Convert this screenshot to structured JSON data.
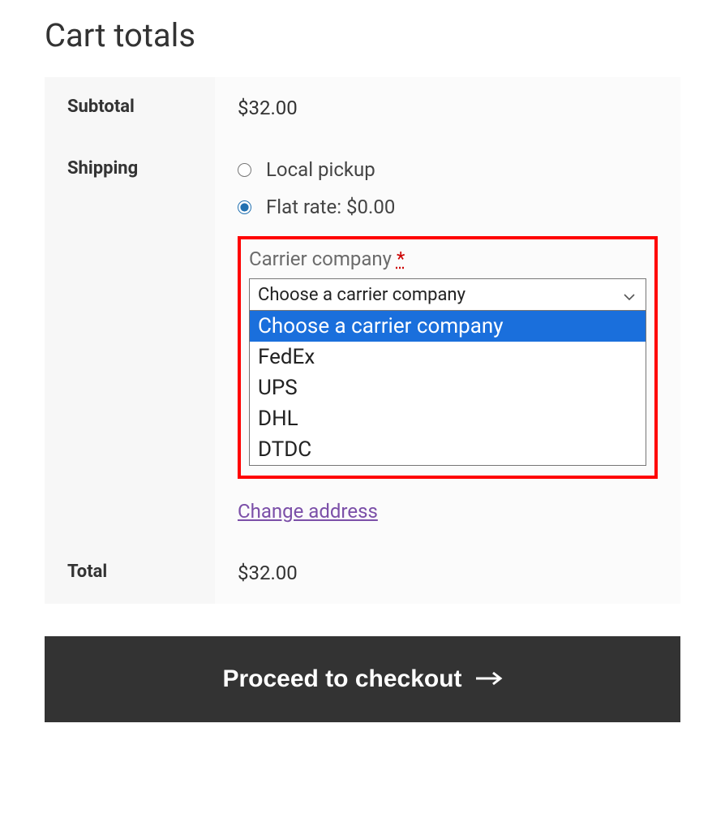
{
  "title": "Cart totals",
  "rows": {
    "subtotal": {
      "label": "Subtotal",
      "value": "$32.00"
    },
    "shipping": {
      "label": "Shipping"
    },
    "total": {
      "label": "Total",
      "value": "$32.00"
    }
  },
  "shipping_options": {
    "local_pickup": {
      "label": "Local pickup",
      "checked": false
    },
    "flat_rate": {
      "label": "Flat rate: $0.00",
      "checked": true
    }
  },
  "carrier": {
    "label": "Carrier company ",
    "required_mark": "*",
    "selected": "Choose a carrier company",
    "options": [
      "Choose a carrier company",
      "FedEx",
      "UPS",
      "DHL",
      "DTDC"
    ],
    "highlighted_index": 0
  },
  "change_address": "Change address",
  "checkout_button": "Proceed to checkout"
}
